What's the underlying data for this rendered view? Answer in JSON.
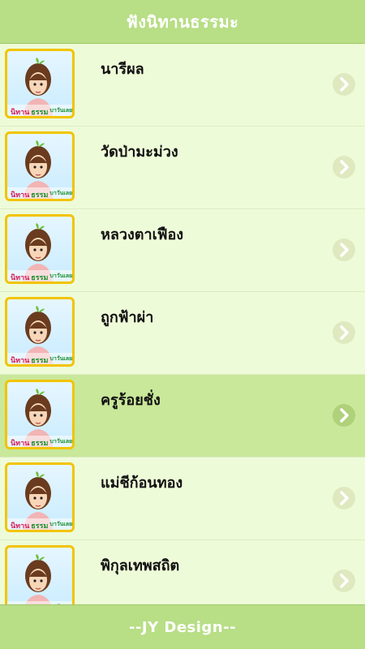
{
  "header": {
    "title": "ฟังนิทานธรรมะ"
  },
  "items": [
    {
      "title": "นารีผล",
      "thumb_icon": "girl-avatar-icon"
    },
    {
      "title": "วัดป่ามะม่วง",
      "thumb_icon": "girl-avatar-icon"
    },
    {
      "title": "หลวงตาเฟือง",
      "thumb_icon": "girl-avatar-icon"
    },
    {
      "title": "ถูกฟ้าผ่า",
      "thumb_icon": "girl-avatar-icon"
    },
    {
      "title": "ครูร้อยชั่ง",
      "thumb_icon": "girl-avatar-icon",
      "selected": true
    },
    {
      "title": "แม่ชีก้อนทอง",
      "thumb_icon": "girl-avatar-icon"
    },
    {
      "title": "พิกุลเทพสถิต",
      "thumb_icon": "girl-avatar-icon"
    }
  ],
  "thumb_caption": {
    "part1": "นิทาน",
    "part2": "ธรรม",
    "part3": "บาวันเลย"
  },
  "footer": {
    "text": "--JY Design--"
  },
  "colors": {
    "header_bg": "#b8de86",
    "row_bg": "#eefbd8",
    "row_selected_bg": "#c9e89a",
    "thumb_border": "#f2c400",
    "chevron_bg": "#dfe9bf"
  }
}
